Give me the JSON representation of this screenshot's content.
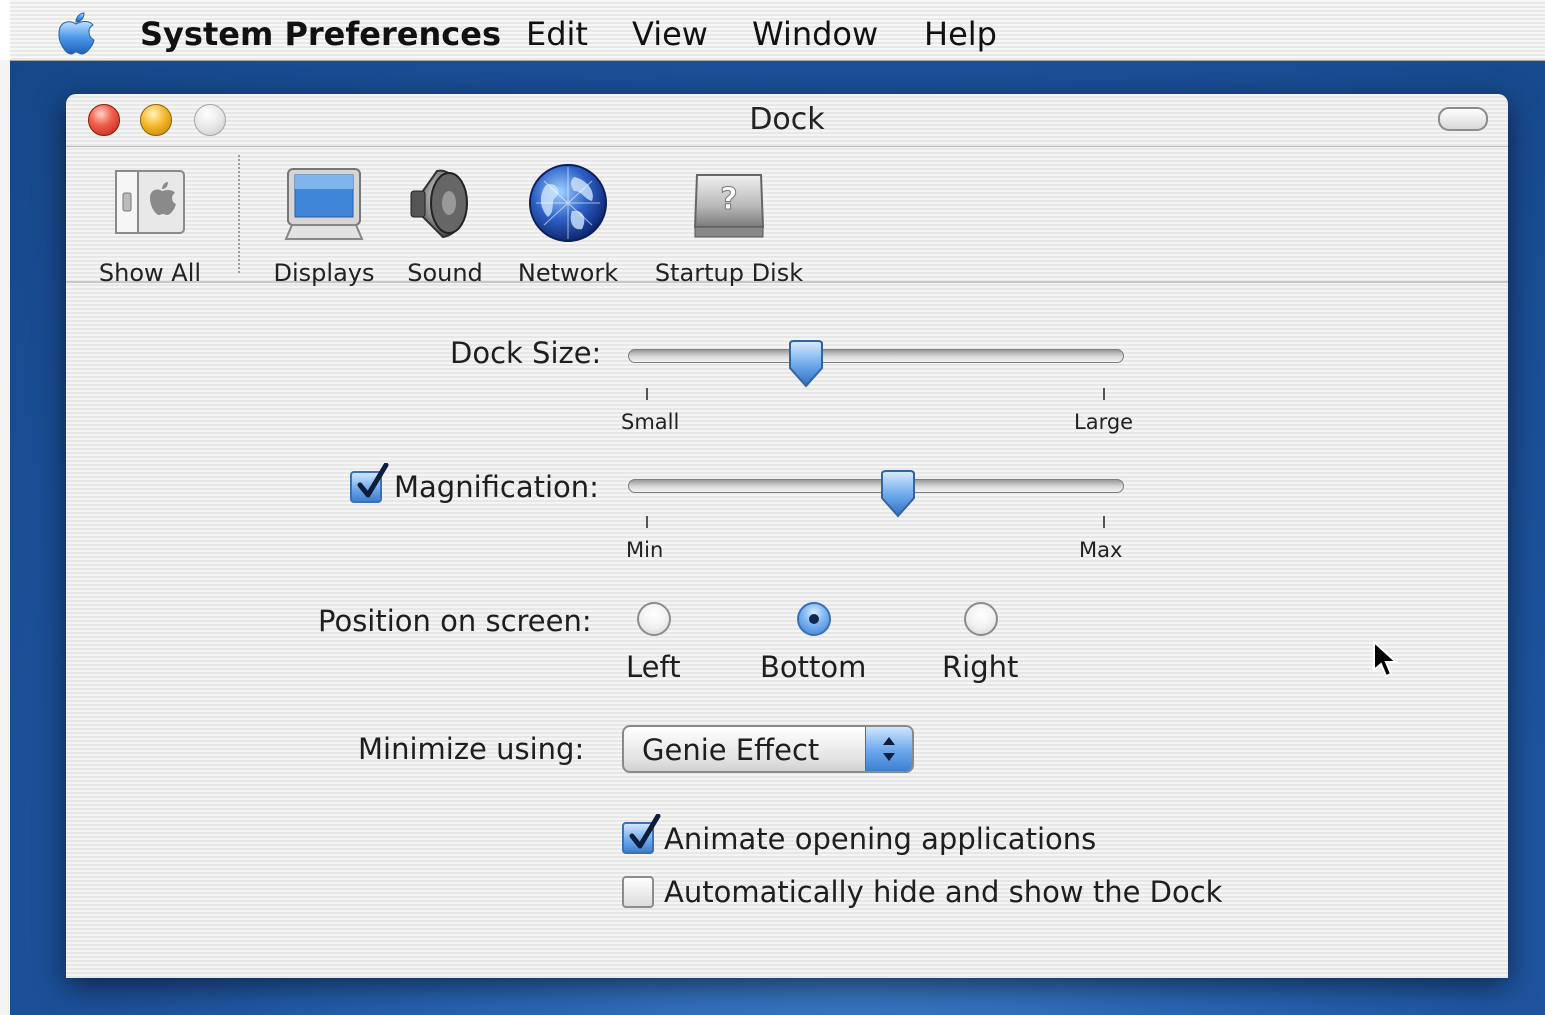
{
  "menubar": {
    "app_name": "System Preferences",
    "items": [
      "Edit",
      "View",
      "Window",
      "Help"
    ]
  },
  "window": {
    "title": "Dock"
  },
  "toolbar": {
    "items": [
      {
        "label": "Show All",
        "icon": "show-all-icon"
      },
      {
        "label": "Displays",
        "icon": "displays-icon"
      },
      {
        "label": "Sound",
        "icon": "sound-icon"
      },
      {
        "label": "Network",
        "icon": "network-icon"
      },
      {
        "label": "Startup Disk",
        "icon": "startup-disk-icon"
      }
    ]
  },
  "dock_size": {
    "label": "Dock Size:",
    "min_label": "Small",
    "max_label": "Large",
    "value_fraction": 0.35
  },
  "magnification": {
    "label": "Magnification:",
    "checked": true,
    "min_label": "Min",
    "max_label": "Max",
    "value_fraction": 0.55
  },
  "position": {
    "label": "Position on screen:",
    "options": [
      "Left",
      "Bottom",
      "Right"
    ],
    "selected": "Bottom"
  },
  "minimize": {
    "label": "Minimize using:",
    "value": "Genie Effect"
  },
  "options": {
    "animate": {
      "label": "Animate opening applications",
      "checked": true
    },
    "autohide": {
      "label": "Automatically hide and show the Dock",
      "checked": false
    }
  },
  "colors": {
    "accent": "#3d7fd0",
    "desktop": "#1d529c"
  }
}
